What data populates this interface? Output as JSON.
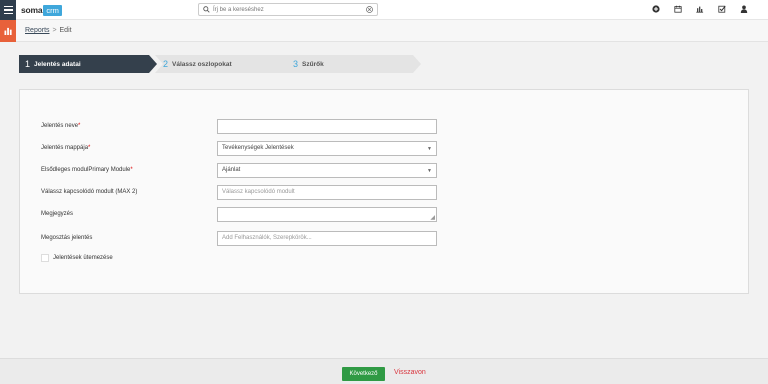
{
  "header": {
    "logo_main": "soma",
    "logo_accent": "crm",
    "search_placeholder": "Írj be a kereséshez",
    "icons": [
      "add-icon",
      "calendar-icon",
      "chart-icon",
      "task-check-icon",
      "user-icon"
    ]
  },
  "breadcrumb": {
    "root": "Reports",
    "separator": ">",
    "current": "Edit"
  },
  "steps": [
    {
      "number": "1",
      "label": "Jelentés adatai",
      "active": true
    },
    {
      "number": "2",
      "label": "Válassz oszlopokat",
      "active": false
    },
    {
      "number": "3",
      "label": "Szűrők",
      "active": false
    }
  ],
  "form": {
    "report_name": {
      "label": "Jelentés neve",
      "required": "*",
      "value": ""
    },
    "report_folder": {
      "label": "Jelentés mappája",
      "required": "*",
      "value": "Tevékenységek Jelentések"
    },
    "primary_module": {
      "label": "Elsődleges modulPrimary Module",
      "required": "*",
      "value": "Ajánlat"
    },
    "related_modules": {
      "label": "Válassz kapcsolódó modult (MAX 2)",
      "placeholder": "Válassz kapcsolódó modult"
    },
    "note": {
      "label": "Megjegyzés",
      "value": ""
    },
    "share": {
      "label": "Megosztás jelentés",
      "placeholder": "Add Felhasználók, Szerepkörök..."
    },
    "schedule": {
      "label": "Jelentések ütemezése"
    }
  },
  "footer": {
    "next_label": "Következő",
    "cancel_label": "Visszavon"
  },
  "colors": {
    "nav_dark": "#2f3e4e",
    "accent_blue": "#3fa7db",
    "accent_orange": "#e8613a",
    "next_green": "#2f9a44",
    "cancel_red": "#d9363e"
  }
}
